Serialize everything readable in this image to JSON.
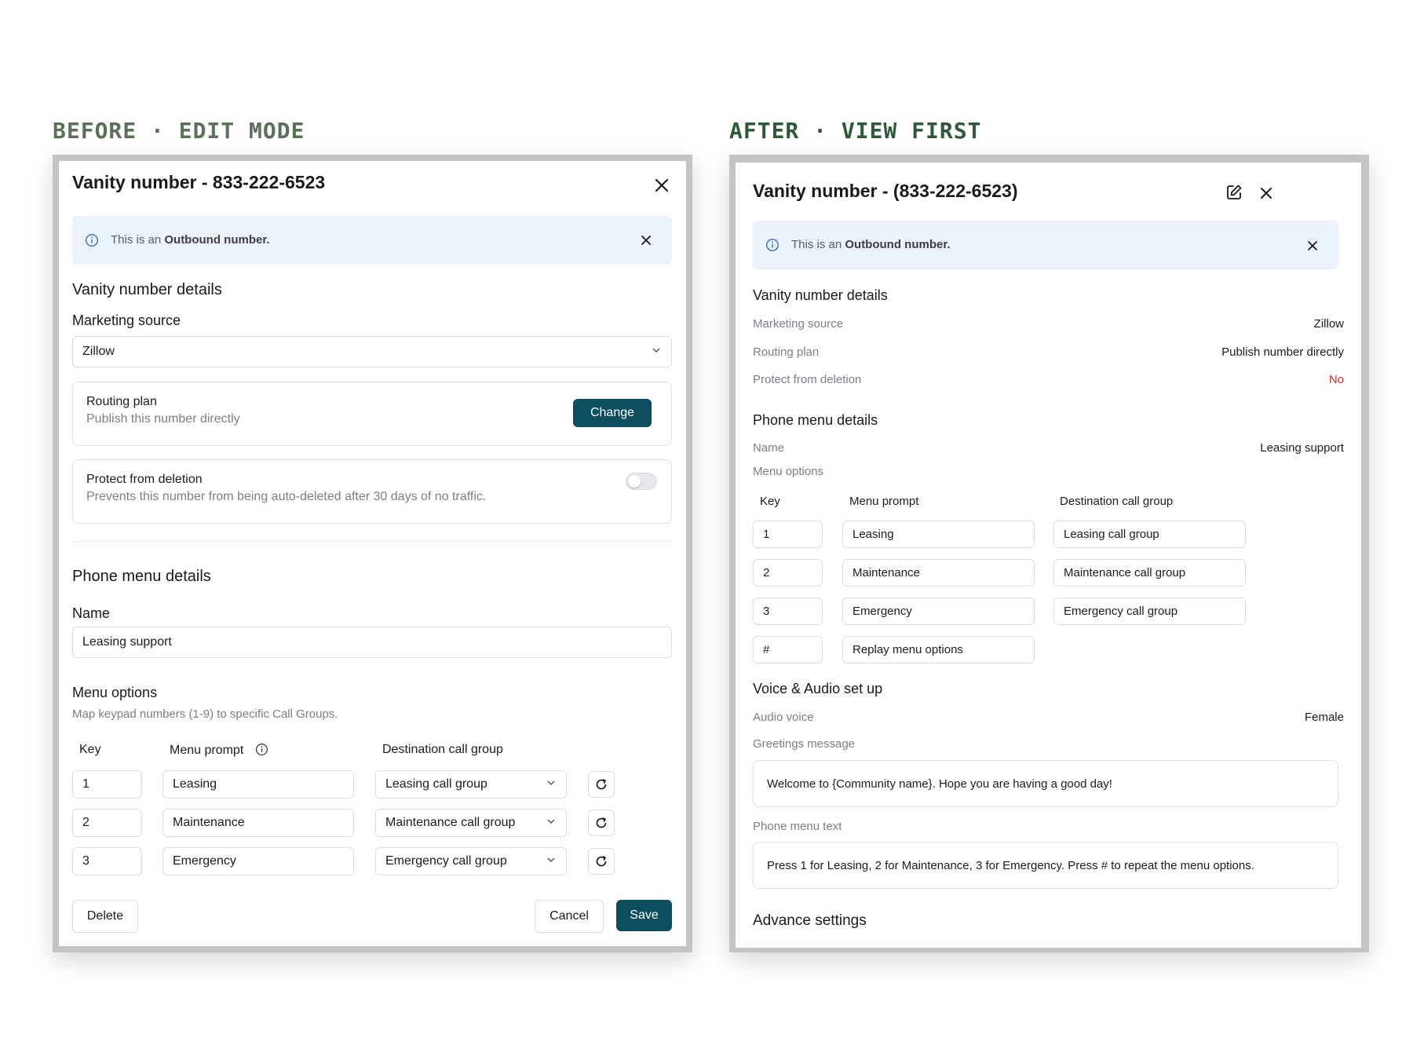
{
  "headings": {
    "before": "BEFORE · EDIT MODE",
    "after": "AFTER · VIEW FIRST"
  },
  "edit_mode": {
    "title": "Vanity number - 833-222-6523",
    "info": {
      "prefix": "This is an ",
      "strong": "Outbound number."
    },
    "section_details": "Vanity number details",
    "marketing_source": {
      "label": "Marketing source",
      "value": "Zillow"
    },
    "routing_plan": {
      "label": "Routing plan",
      "description": "Publish this number directly",
      "button": "Change"
    },
    "protect": {
      "label": "Protect from deletion",
      "description": "Prevents this number from being auto-deleted after 30 days of no traffic.",
      "enabled": false
    },
    "section_phone_menu": "Phone menu details",
    "name": {
      "label": "Name",
      "value": "Leasing support"
    },
    "menu_options": {
      "label": "Menu options",
      "description": "Map keypad numbers (1-9) to specific Call Groups.",
      "headers": {
        "key": "Key",
        "prompt": "Menu prompt",
        "destination": "Destination call group"
      },
      "rows": [
        {
          "key": "1",
          "prompt": "Leasing",
          "destination": "Leasing call group"
        },
        {
          "key": "2",
          "prompt": "Maintenance",
          "destination": "Maintenance call group"
        },
        {
          "key": "3",
          "prompt": "Emergency",
          "destination": "Emergency call group"
        }
      ]
    },
    "buttons": {
      "delete": "Delete",
      "cancel": "Cancel",
      "save": "Save"
    }
  },
  "view_mode": {
    "title": "Vanity number - (833-222-6523)",
    "info": {
      "prefix": "This is an ",
      "strong": "Outbound number."
    },
    "section_details": "Vanity number details",
    "details": [
      {
        "label": "Marketing source",
        "value": "Zillow"
      },
      {
        "label": "Routing plan",
        "value": "Publish number directly"
      },
      {
        "label": "Protect from deletion",
        "value": "No"
      }
    ],
    "section_phone_menu": "Phone menu details",
    "name": {
      "label": "Name",
      "value": "Leasing support"
    },
    "menu_options_label": "Menu options",
    "headers": {
      "key": "Key",
      "prompt": "Menu prompt",
      "destination": "Destination call group"
    },
    "rows": [
      {
        "key": "1",
        "prompt": "Leasing",
        "destination": "Leasing call group"
      },
      {
        "key": "2",
        "prompt": "Maintenance",
        "destination": "Maintenance call group"
      },
      {
        "key": "3",
        "prompt": "Emergency",
        "destination": "Emergency call group"
      },
      {
        "key": "#",
        "prompt": "Replay menu options",
        "destination": ""
      }
    ],
    "section_voice": "Voice & Audio set up",
    "audio_voice": {
      "label": "Audio voice",
      "value": "Female"
    },
    "greetings": {
      "label": "Greetings message",
      "value": "Welcome to {Community name}. Hope you are having a good day!"
    },
    "phone_menu_text": {
      "label": "Phone menu text",
      "value": "Press 1 for Leasing, 2 for Maintenance, 3 for Emergency. Press # to repeat the menu options."
    },
    "section_advance": "Advance settings"
  },
  "colors": {
    "primary": "#0e4f5f",
    "info_bg": "#ebf2fb",
    "danger": "#d3332d",
    "heading_before": "#5a7157",
    "heading_after": "#2f5a3a"
  }
}
